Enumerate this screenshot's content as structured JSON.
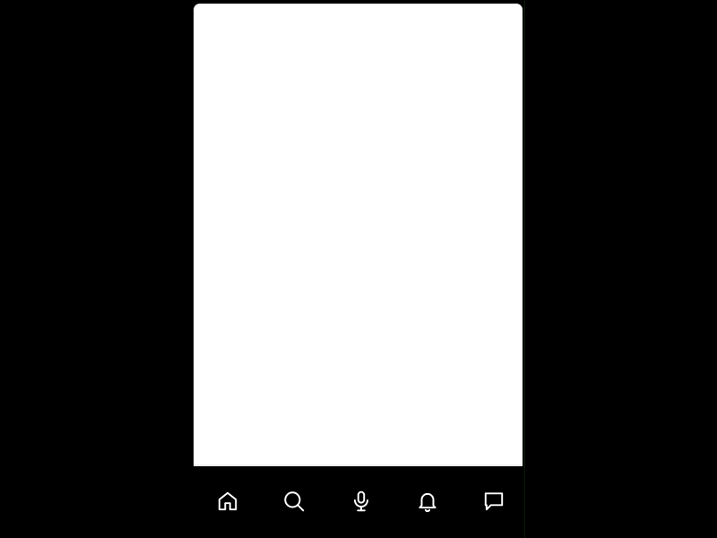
{
  "colors": {
    "background": "#000000",
    "content": "#ffffff",
    "nav_icon": "#ffffff"
  },
  "bottom_nav": {
    "items": [
      {
        "icon": "home-icon"
      },
      {
        "icon": "search-icon"
      },
      {
        "icon": "microphone-icon"
      },
      {
        "icon": "bell-icon"
      },
      {
        "icon": "chat-icon"
      }
    ]
  }
}
